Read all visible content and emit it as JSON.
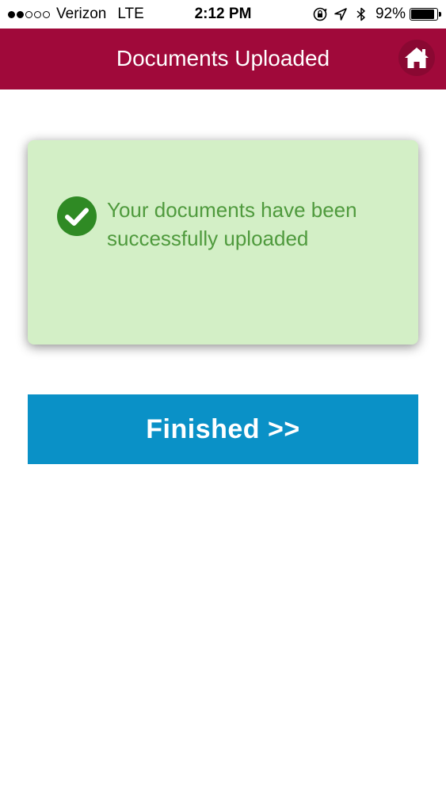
{
  "status_bar": {
    "signal_filled": 2,
    "signal_total": 5,
    "carrier": "Verizon",
    "network": "LTE",
    "time": "2:12 PM",
    "icons": [
      "rotation-lock-icon",
      "location-arrow-icon",
      "bluetooth-icon"
    ],
    "battery_percent": "92%",
    "battery_level": 0.92
  },
  "header": {
    "title": "Documents Uploaded",
    "home_icon": "home-icon",
    "background_color": "#a0093a"
  },
  "success_card": {
    "icon": "check-circle-icon",
    "message": "Your documents have been successfully uploaded",
    "background_color": "#d3efc6",
    "text_color": "#4f9a3d"
  },
  "finished_button": {
    "label": "Finished >>",
    "background_color": "#0a91c7"
  }
}
